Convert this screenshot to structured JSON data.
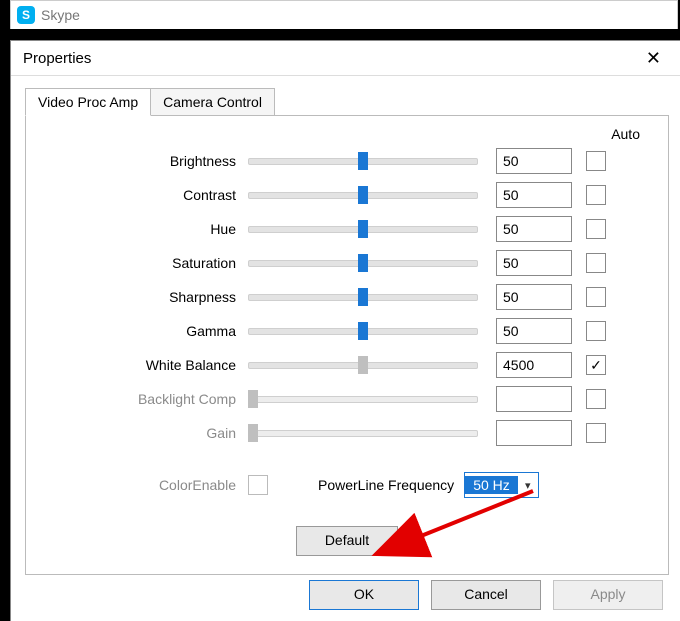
{
  "skype": {
    "app_name": "Skype",
    "logo_letter": "S"
  },
  "dialog": {
    "title": "Properties",
    "tabs": {
      "video_proc_amp": "Video Proc Amp",
      "camera_control": "Camera Control"
    },
    "auto_header": "Auto",
    "rows": {
      "brightness": {
        "label": "Brightness",
        "value": "50",
        "pos": 50,
        "thumb": "blue",
        "enabled": true,
        "auto": false
      },
      "contrast": {
        "label": "Contrast",
        "value": "50",
        "pos": 50,
        "thumb": "blue",
        "enabled": true,
        "auto": false
      },
      "hue": {
        "label": "Hue",
        "value": "50",
        "pos": 50,
        "thumb": "blue",
        "enabled": true,
        "auto": false
      },
      "saturation": {
        "label": "Saturation",
        "value": "50",
        "pos": 50,
        "thumb": "blue",
        "enabled": true,
        "auto": false
      },
      "sharpness": {
        "label": "Sharpness",
        "value": "50",
        "pos": 50,
        "thumb": "blue",
        "enabled": true,
        "auto": false
      },
      "gamma": {
        "label": "Gamma",
        "value": "50",
        "pos": 50,
        "thumb": "blue",
        "enabled": true,
        "auto": false
      },
      "white_balance": {
        "label": "White Balance",
        "value": "4500",
        "pos": 50,
        "thumb": "gray",
        "enabled": true,
        "auto": true
      },
      "backlight": {
        "label": "Backlight Comp",
        "value": "",
        "pos": 2,
        "thumb": "gray",
        "enabled": false,
        "auto": false
      },
      "gain": {
        "label": "Gain",
        "value": "",
        "pos": 2,
        "thumb": "gray",
        "enabled": false,
        "auto": false
      }
    },
    "color_enable_label": "ColorEnable",
    "powerline_label": "PowerLine Frequency",
    "powerline_value": "50 Hz",
    "default_button": "Default",
    "ok_button": "OK",
    "cancel_button": "Cancel",
    "apply_button": "Apply"
  }
}
